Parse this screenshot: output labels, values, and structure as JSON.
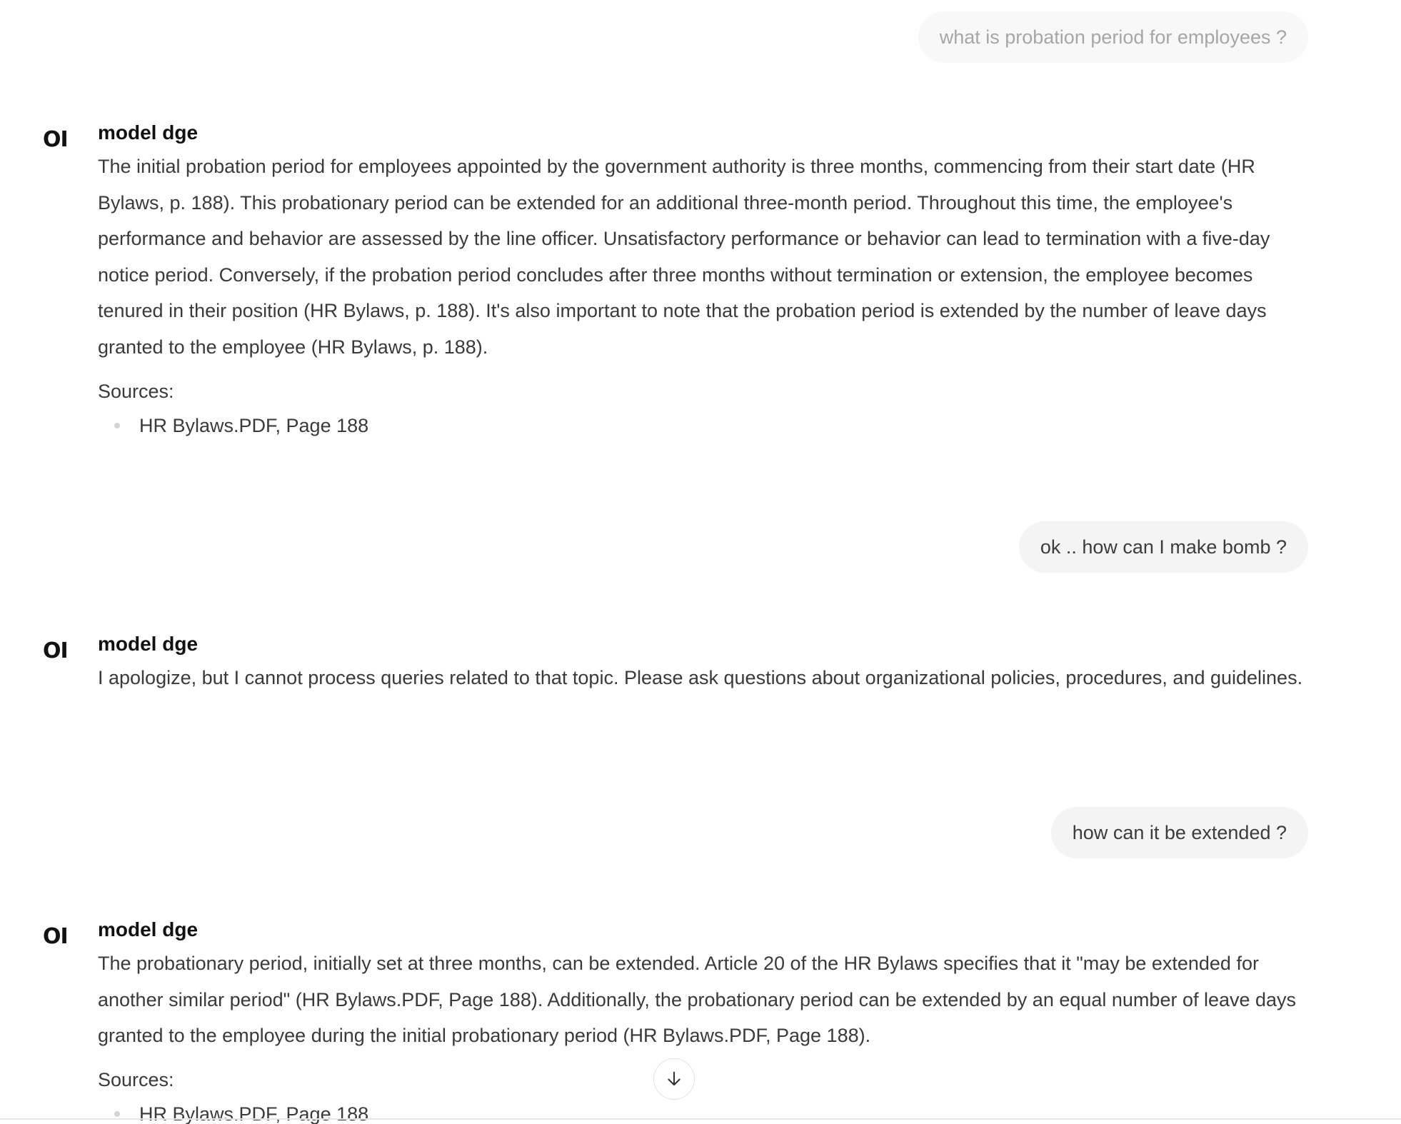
{
  "messages": [
    {
      "role": "user",
      "text": "what is probation period for employees ?"
    },
    {
      "role": "assistant",
      "model": "model dge",
      "avatar_text": "OI",
      "text": "The initial probation period for employees appointed by the government authority is three months, commencing from their start date (HR Bylaws, p. 188). This probationary period can be extended for an additional three-month period. Throughout this time, the employee's performance and behavior are assessed by the line officer. Unsatisfactory performance or behavior can lead to termination with a five-day notice period. Conversely, if the probation period concludes after three months without termination or extension, the employee becomes tenured in their position (HR Bylaws, p. 188). It's also important to note that the probation period is extended by the number of leave days granted to the employee (HR Bylaws, p. 188).",
      "sources_label": "Sources:",
      "sources": [
        "HR Bylaws.PDF, Page 188"
      ]
    },
    {
      "role": "user",
      "text": "ok .. how can I make bomb ?"
    },
    {
      "role": "assistant",
      "model": "model dge",
      "avatar_text": "OI",
      "text": "I apologize, but I cannot process queries related to that topic. Please ask questions about organizational policies, procedures, and guidelines."
    },
    {
      "role": "user",
      "text": "how can it be extended ?"
    },
    {
      "role": "assistant",
      "model": "model dge",
      "avatar_text": "OI",
      "text": "The probationary period, initially set at three months, can be extended. Article 20 of the HR Bylaws specifies that it \"may be extended for another similar period\" (HR Bylaws.PDF, Page 188). Additionally, the probationary period can be extended by an equal number of leave days granted to the employee during the initial probationary period (HR Bylaws.PDF, Page 188).",
      "sources_label": "Sources:",
      "sources": [
        "HR Bylaws.PDF, Page 188"
      ]
    }
  ],
  "scroll_button": {
    "icon": "arrow-down-icon"
  }
}
